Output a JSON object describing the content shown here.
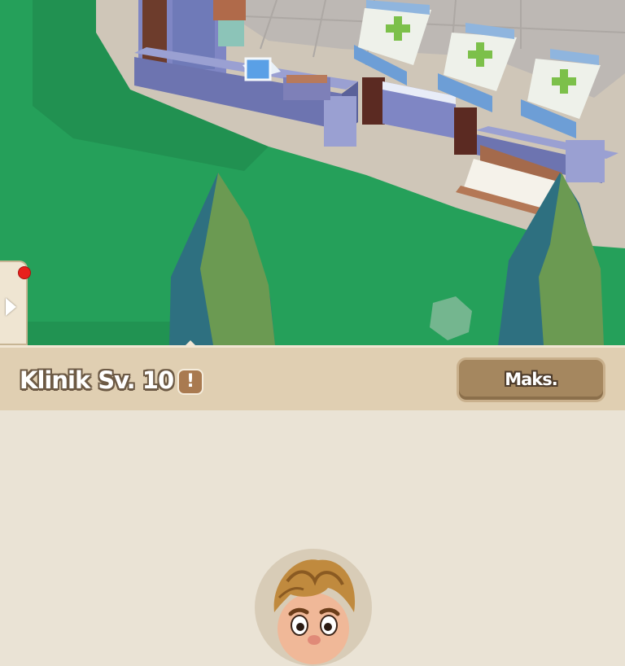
{
  "header": {
    "building_name": "Klinik",
    "level_label": "Sv. 10",
    "info_symbol": "!",
    "max_button_label": "Maks."
  },
  "icons": {
    "side_tab": "play-arrow-icon",
    "notification": "red-dot-icon",
    "info": "exclamation-icon",
    "bed": "medical-cross-icon"
  },
  "colors": {
    "grass": "#25a05a",
    "header_bar": "#e0cfb2",
    "panel_background": "#eae3d5",
    "max_button": "#a5875f",
    "notification_dot": "#e8201c",
    "cross": "#7cc04a"
  }
}
